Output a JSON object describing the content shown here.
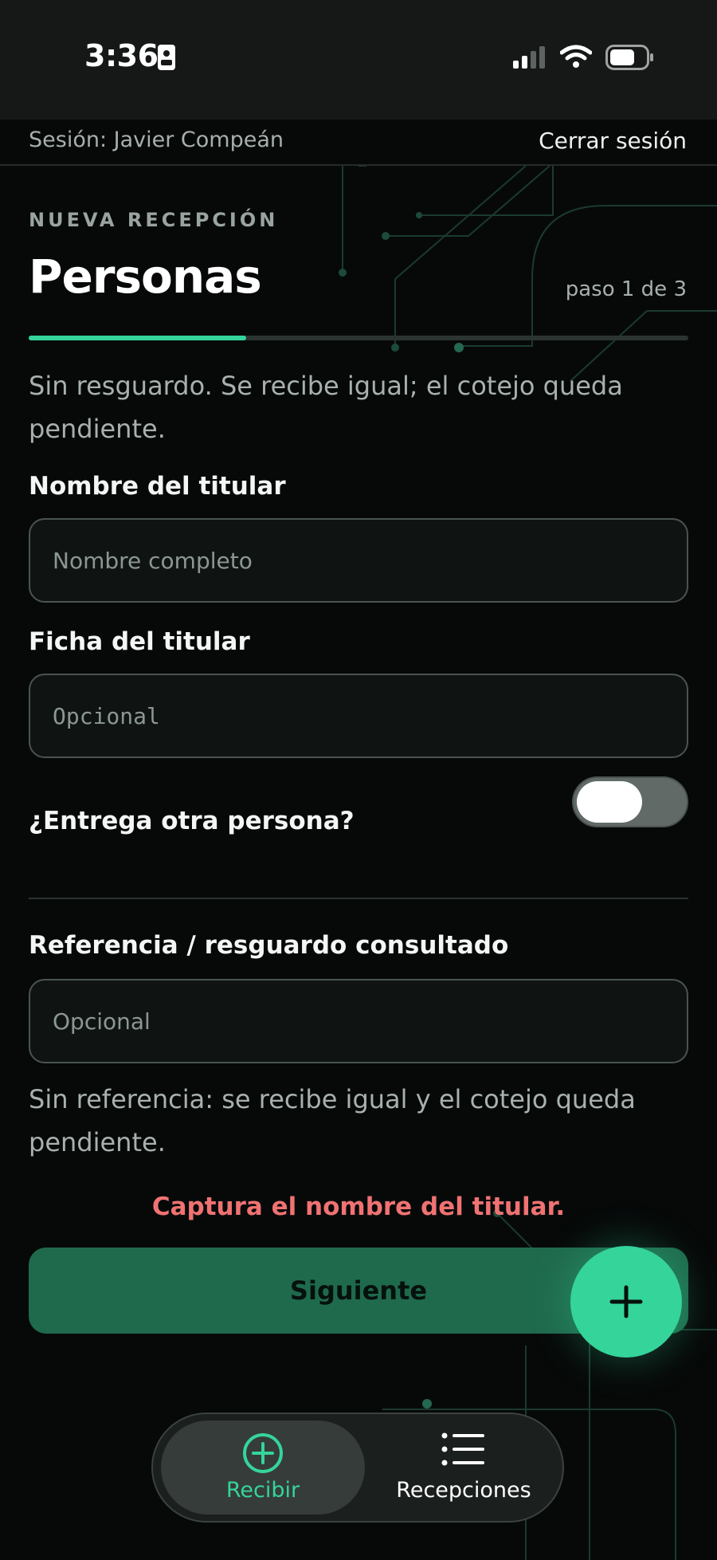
{
  "status_bar": {
    "time": "3:36",
    "icons": [
      "id-card-icon",
      "cellular-signal-icon",
      "wifi-icon",
      "battery-icon"
    ]
  },
  "session": {
    "label": "Sesión: Javier Compeán",
    "logout_label": "Cerrar sesión"
  },
  "header": {
    "overline": "NUEVA RECEPCIÓN",
    "title": "Personas",
    "step": "paso 1 de 3",
    "progress_fraction": 0.33
  },
  "info_note": "Sin resguardo. Se recibe igual; el cotejo queda pendiente.",
  "form": {
    "holder_name": {
      "label": "Nombre del titular",
      "placeholder": "Nombre completo",
      "value": ""
    },
    "holder_id": {
      "label": "Ficha del titular",
      "placeholder": "Opcional",
      "value": ""
    },
    "other_person": {
      "label": "¿Entrega otra persona?",
      "enabled": false
    },
    "reference": {
      "label": "Referencia / resguardo consultado",
      "placeholder": "Opcional",
      "value": ""
    },
    "reference_help": "Sin referencia: se recibe igual y el cotejo queda pendiente."
  },
  "error_message": "Captura el nombre del titular.",
  "next_button_label": "Siguiente",
  "fab_icon": "plus-icon",
  "tabs": [
    {
      "label": "Recibir",
      "icon": "plus-circle-icon",
      "active": true
    },
    {
      "label": "Recepciones",
      "icon": "list-icon",
      "active": false
    }
  ],
  "colors": {
    "accent": "#35d49b",
    "background": "#070909",
    "error": "#f07272",
    "button": "#1f6a4d"
  }
}
